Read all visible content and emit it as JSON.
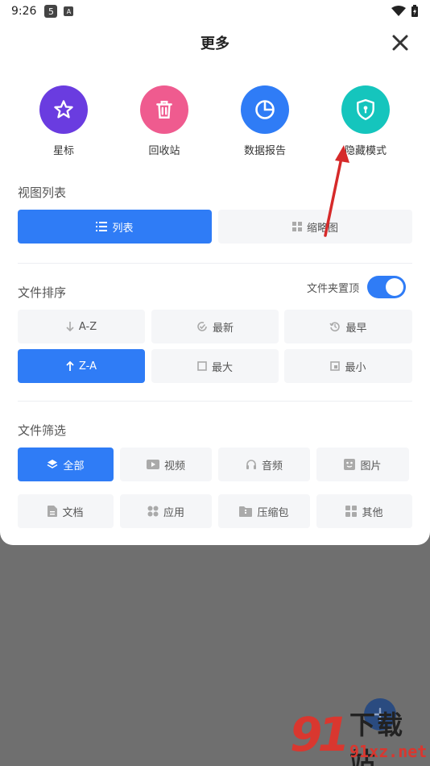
{
  "status_bar": {
    "time": "9:26",
    "badge1": "5",
    "badge2": "A"
  },
  "sheet": {
    "title": "更多"
  },
  "quick_actions": [
    {
      "label": "星标",
      "icon": "star-icon",
      "color": "#6a3ce0"
    },
    {
      "label": "回收站",
      "icon": "trash-icon",
      "color": "#ef5b8f"
    },
    {
      "label": "数据报告",
      "icon": "pie-chart-icon",
      "color": "#2f7cf6"
    },
    {
      "label": "隐藏模式",
      "icon": "shield-lock-icon",
      "color": "#15c5bd"
    }
  ],
  "view_list": {
    "title": "视图列表",
    "options": [
      {
        "label": "列表",
        "icon": "list-icon",
        "active": true
      },
      {
        "label": "缩略图",
        "icon": "grid-icon",
        "active": false
      }
    ]
  },
  "sort": {
    "title": "文件排序",
    "folder_top_label": "文件夹置顶",
    "folder_top_on": true,
    "options": [
      {
        "label": "A-Z",
        "icon": "arrow-down-icon",
        "active": false
      },
      {
        "label": "最新",
        "icon": "clock-check-icon",
        "active": false
      },
      {
        "label": "最早",
        "icon": "history-icon",
        "active": false
      },
      {
        "label": "Z-A",
        "icon": "arrow-up-icon",
        "active": true
      },
      {
        "label": "最大",
        "icon": "square-icon",
        "active": false
      },
      {
        "label": "最小",
        "icon": "square-small-icon",
        "active": false
      }
    ]
  },
  "filter": {
    "title": "文件筛选",
    "options": [
      {
        "label": "全部",
        "icon": "layers-icon",
        "active": true
      },
      {
        "label": "视频",
        "icon": "video-icon",
        "active": false
      },
      {
        "label": "音频",
        "icon": "headphones-icon",
        "active": false
      },
      {
        "label": "图片",
        "icon": "image-icon",
        "active": false
      },
      {
        "label": "文档",
        "icon": "document-icon",
        "active": false
      },
      {
        "label": "应用",
        "icon": "apps-icon",
        "active": false
      },
      {
        "label": "压缩包",
        "icon": "archive-icon",
        "active": false
      },
      {
        "label": "其他",
        "icon": "grid-icon",
        "active": false
      }
    ]
  },
  "watermark": {
    "logo": "91",
    "text1": "下载站",
    "text2": "91xz.net"
  },
  "colors": {
    "accent": "#2f7cf6",
    "arrow": "#d62a2a"
  }
}
